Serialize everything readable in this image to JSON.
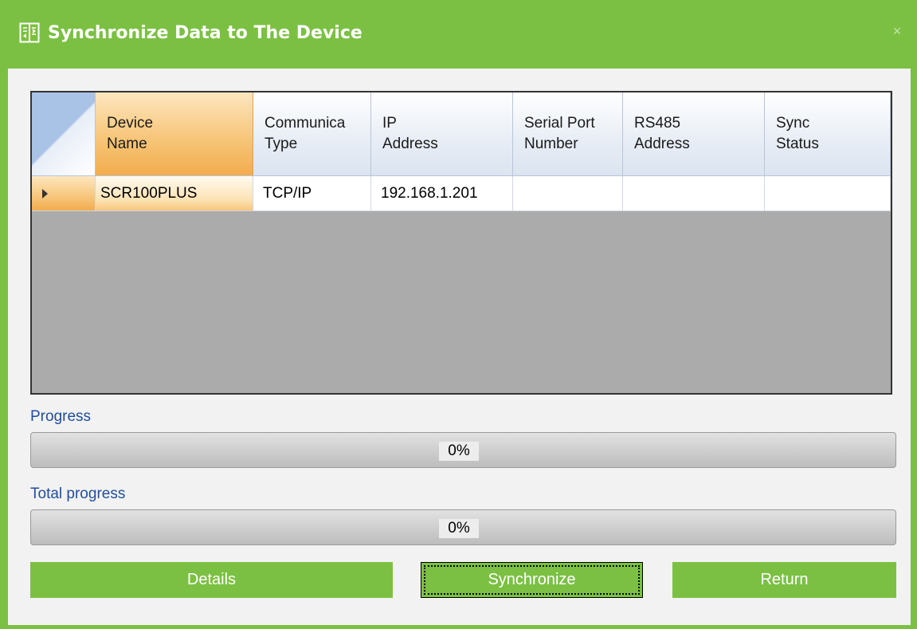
{
  "window": {
    "title": "Synchronize Data to The Device",
    "accent_color": "#7bc043",
    "title_icon": "sync-data-icon",
    "close_icon": "close-icon",
    "close_glyph": "×"
  },
  "grid": {
    "columns": [
      {
        "key": "device_name",
        "label": "Device Name"
      },
      {
        "key": "comm_type",
        "label": "Communica Type"
      },
      {
        "key": "ip",
        "label": "IP Address"
      },
      {
        "key": "serial_port",
        "label": "Serial Port Number"
      },
      {
        "key": "rs485",
        "label": "RS485 Address"
      },
      {
        "key": "sync_status",
        "label": "Sync Status"
      }
    ],
    "rows": [
      {
        "device_name": "SCR100PLUS",
        "comm_type": "TCP/IP",
        "ip": "192.168.1.201",
        "serial_port": "",
        "rs485": "",
        "sync_status": ""
      }
    ]
  },
  "progress": {
    "label": "Progress",
    "value": 0,
    "text": "0%"
  },
  "total_progress": {
    "label": "Total progress",
    "value": 0,
    "text": "0%"
  },
  "buttons": {
    "details": "Details",
    "synchronize": "Synchronize",
    "return": "Return"
  }
}
